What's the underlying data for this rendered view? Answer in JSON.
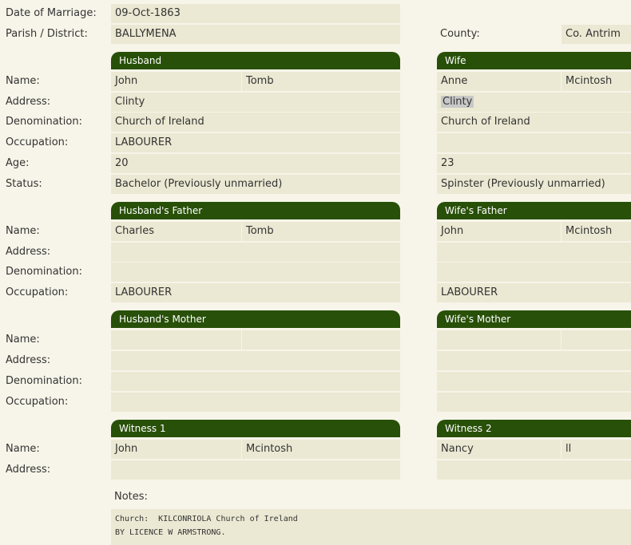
{
  "labels": {
    "date_of_marriage": "Date of Marriage:",
    "parish": "Parish / District:",
    "county": "County:",
    "name": "Name:",
    "address": "Address:",
    "denomination": "Denomination:",
    "occupation": "Occupation:",
    "age": "Age:",
    "status": "Status:",
    "notes": "Notes:"
  },
  "marriage": {
    "date": "09-Oct-1863",
    "parish": "BALLYMENA",
    "county": "Co. Antrim"
  },
  "headers": {
    "husband": "Husband",
    "wife": "Wife",
    "husbands_father": "Husband's Father",
    "wifes_father": "Wife's Father",
    "husbands_mother": "Husband's Mother",
    "wifes_mother": "Wife's Mother",
    "witness1": "Witness 1",
    "witness2": "Witness 2"
  },
  "husband": {
    "first_name": "John",
    "surname": "Tomb",
    "address": "Clinty",
    "denomination": "Church of Ireland",
    "occupation": "LABOURER",
    "age": "20",
    "status": "Bachelor (Previously unmarried)"
  },
  "wife": {
    "first_name": "Anne",
    "surname": "Mcintosh",
    "address": "Clinty",
    "denomination": "Church of Ireland",
    "occupation": "",
    "age": "23",
    "status": "Spinster (Previously unmarried)"
  },
  "husbands_father": {
    "first_name": "Charles",
    "surname": "Tomb",
    "address": "",
    "denomination": "",
    "occupation": "LABOURER"
  },
  "wifes_father": {
    "first_name": "John",
    "surname": "Mcintosh",
    "address": "",
    "denomination": "",
    "occupation": "LABOURER"
  },
  "husbands_mother": {
    "first_name": "",
    "surname": "",
    "address": "",
    "denomination": "",
    "occupation": ""
  },
  "wifes_mother": {
    "first_name": "",
    "surname": "",
    "address": "",
    "denomination": "",
    "occupation": ""
  },
  "witness1": {
    "first_name": "John",
    "surname": "Mcintosh",
    "address": ""
  },
  "witness2": {
    "first_name": "Nancy",
    "surname": "ll",
    "address": ""
  },
  "notes": {
    "text": "Church:  KILCONRIOLA Church of Ireland\nBY LICENCE W ARMSTRONG."
  }
}
